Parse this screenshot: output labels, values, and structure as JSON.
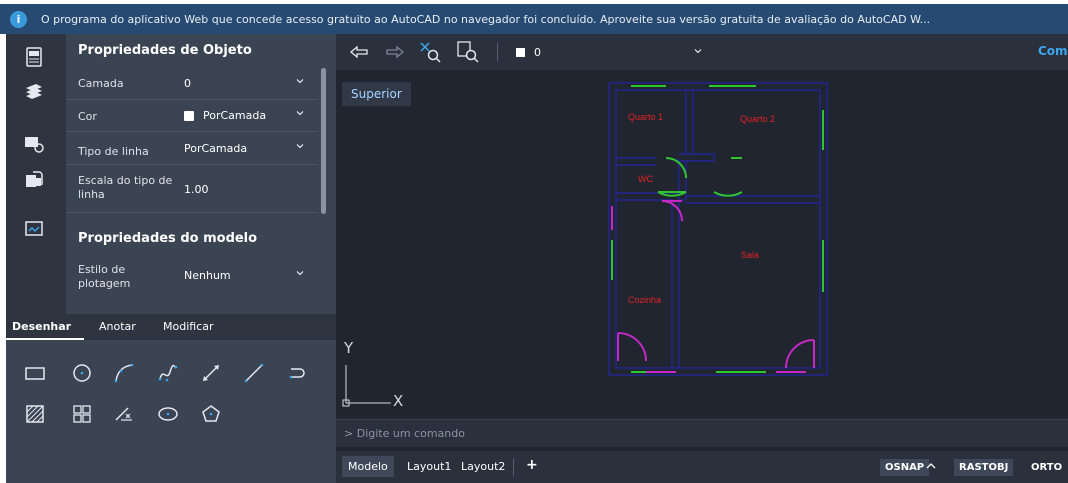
{
  "banner": {
    "info_icon": "i",
    "text": "O programa do aplicativo Web que concede acesso gratuito ao AutoCAD no navegador foi concluído. Aproveite sua versão gratuita de avaliação do AutoCAD W..."
  },
  "sidebar_icons": [
    "properties-panel-icon",
    "layers-icon",
    "blocks-icon",
    "attach-icon",
    "views-icon"
  ],
  "properties": {
    "object_header": "Propriedades de Objeto",
    "rows": [
      {
        "label": "Camada",
        "value": "0"
      },
      {
        "label": "Cor",
        "value": "PorCamada"
      },
      {
        "label": "Tipo de linha",
        "value": "PorCamada"
      },
      {
        "label": "Escala do tipo de linha",
        "value": "1.00"
      }
    ],
    "model_header": "Propriedades do modelo",
    "plot_style": {
      "label": "Estilo de plotagem",
      "value": "Nenhum"
    }
  },
  "tool_tabs": [
    "Desenhar",
    "Anotar",
    "Modificar"
  ],
  "draw_tools": [
    "rectangle-icon",
    "circle-icon",
    "arc-icon",
    "spline-icon",
    "dimension-icon",
    "line-icon",
    "polyline-icon",
    "hatch-icon",
    "grid-icon",
    "trim-icon",
    "ellipse-icon",
    "polygon-icon"
  ],
  "toolbar": {
    "layer_value": "0",
    "right_label": "Comp"
  },
  "viewport": {
    "view_label": "Superior",
    "rooms": [
      "Quarto 1",
      "Quarto 2",
      "WC",
      "Sala",
      "Cozinha"
    ],
    "axis_y": "Y",
    "axis_x": "X"
  },
  "command": {
    "placeholder": "Digite um comando"
  },
  "layouts": {
    "tabs": [
      "Modelo",
      "Layout1",
      "Layout2"
    ],
    "add": "+"
  },
  "status": {
    "osnap": "OSNAP",
    "rastobj": "RASTOBJ",
    "orto": "ORTO"
  },
  "colors": {
    "wall": "#2525a8",
    "door": "#2fc52f",
    "window": "#c528c5",
    "room_text": "#e42222",
    "accent": "#3da5f0"
  }
}
